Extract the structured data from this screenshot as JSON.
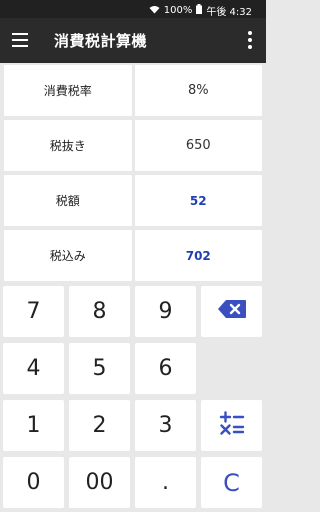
{
  "status_bar": {
    "battery": "100%",
    "time": "午後 4:32"
  },
  "app": {
    "title": "消費税計算機"
  },
  "rows": [
    {
      "label": "消費税率",
      "value": "8%",
      "highlight": false
    },
    {
      "label": "税抜き",
      "value": "650",
      "highlight": false
    },
    {
      "label": "税額",
      "value": "52",
      "highlight": true
    },
    {
      "label": "税込み",
      "value": "702",
      "highlight": true
    }
  ],
  "keypad": {
    "k7": "7",
    "k8": "8",
    "k9": "9",
    "k4": "4",
    "k5": "5",
    "k6": "6",
    "k1": "1",
    "k2": "2",
    "k3": "3",
    "k0": "0",
    "k00": "00",
    "dot": ".",
    "clear": "C"
  },
  "colors": {
    "accent": "#3a4fc0",
    "value_highlight": "#1f3fb3",
    "appbar": "#2b2b2b"
  }
}
